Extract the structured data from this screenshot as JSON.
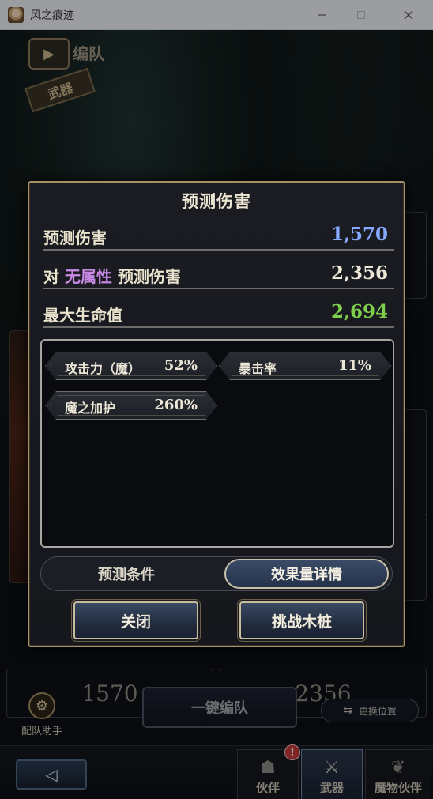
{
  "window": {
    "title": "风之痕迹",
    "minimize_icon": "minimize-icon",
    "maximize_icon": "maximize-icon",
    "close_icon": "close-icon"
  },
  "background": {
    "header_label": "编队",
    "weapon_stamp": "武器",
    "cell_left_value": "1570",
    "cell_right_value": "2356",
    "assist_label": "配队助手",
    "onekey_label": "一键编队",
    "swap_label": "更换位置",
    "nav": {
      "partner_label": "伙伴",
      "weapon_label": "武器",
      "monster_label": "魔物伙伴",
      "badge": "!"
    }
  },
  "modal": {
    "title": "预测伤害",
    "stats": [
      {
        "label": "预测伤害",
        "value": "1,570",
        "color": "#86a8ff"
      },
      {
        "label_prefix": "对",
        "label_attr": "无属性",
        "label_suffix": "预测伤害",
        "value": "2,356",
        "color": "#ece6d6"
      },
      {
        "label": "最大生命值",
        "value": "2,694",
        "color": "#7fcf4c"
      }
    ],
    "buffs": [
      {
        "name": "攻击力（魔）",
        "value": "52%"
      },
      {
        "name": "暴击率",
        "value": "11%"
      },
      {
        "name": "魔之加护",
        "value": "260%"
      }
    ],
    "tabs": {
      "conditions": "预测条件",
      "details": "效果量详情",
      "active": "details"
    },
    "buttons": {
      "close": "关闭",
      "challenge": "挑战木桩"
    }
  }
}
